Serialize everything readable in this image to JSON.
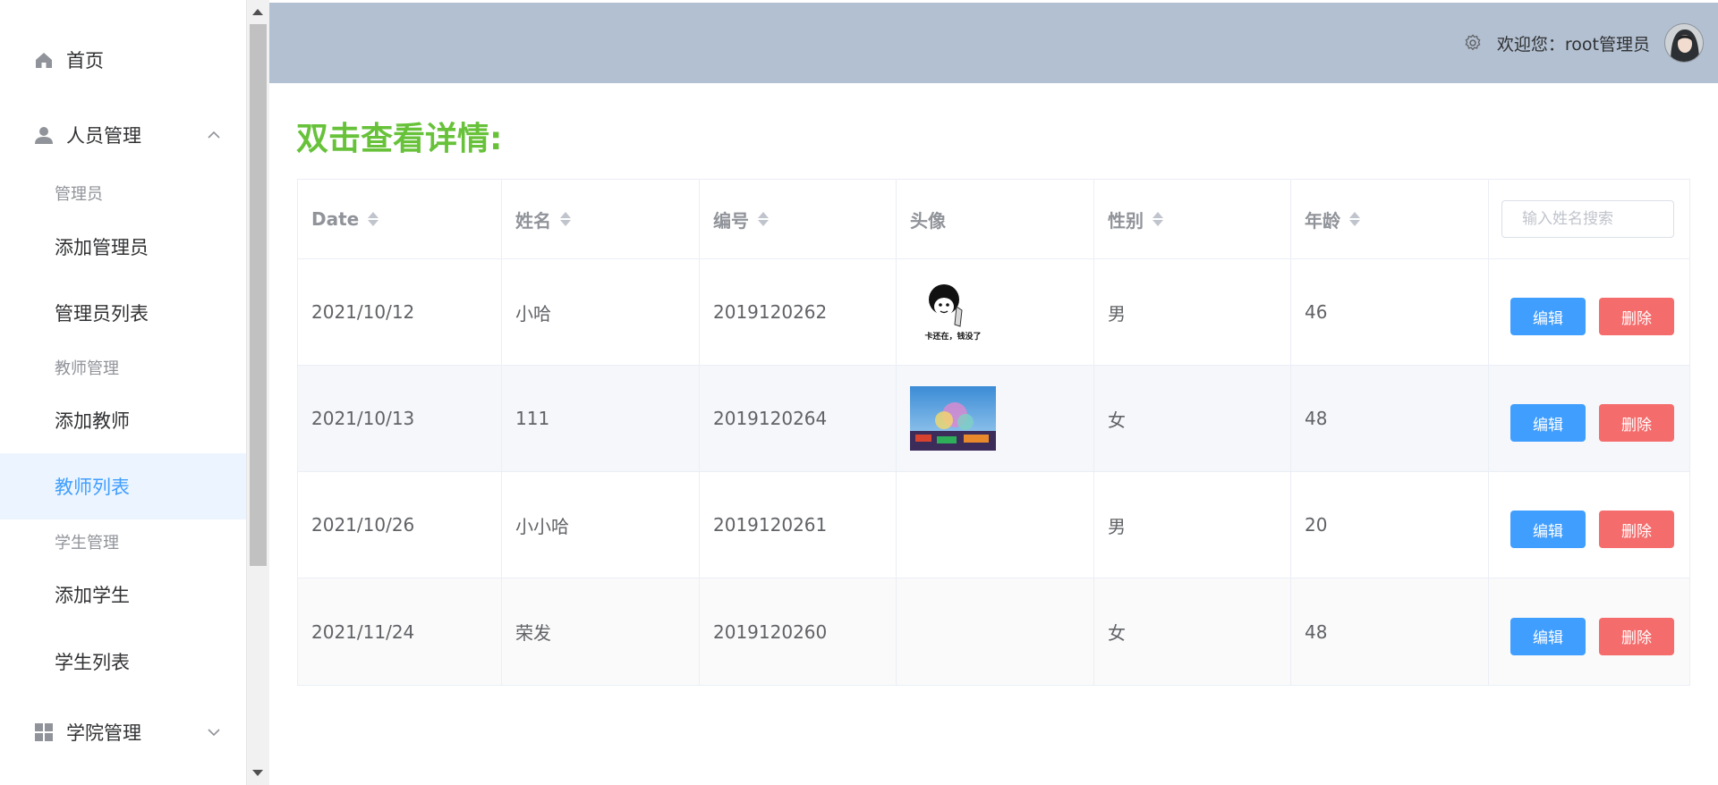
{
  "sidebar": {
    "home": "首页",
    "personnel": "人员管理",
    "admin_group": "管理员",
    "add_admin": "添加管理员",
    "admin_list": "管理员列表",
    "teacher_group": "教师管理",
    "add_teacher": "添加教师",
    "teacher_list": "教师列表",
    "student_group": "学生管理",
    "add_student": "添加学生",
    "student_list": "学生列表",
    "college": "学院管理"
  },
  "header": {
    "welcome": "欢迎您：root管理员"
  },
  "main": {
    "title": "双击查看详情:",
    "search_placeholder": "输入姓名搜索",
    "columns": [
      "Date",
      "姓名",
      "编号",
      "头像",
      "性别",
      "年龄"
    ],
    "edit_label": "编辑",
    "delete_label": "删除",
    "rows": [
      {
        "date": "2021/10/12",
        "name": "小哈",
        "id": "2019120262",
        "avatar_caption": "卡还在，钱没了",
        "gender": "男",
        "age": "46"
      },
      {
        "date": "2021/10/13",
        "name": "111",
        "id": "2019120264",
        "gender": "女",
        "age": "48"
      },
      {
        "date": "2021/10/26",
        "name": "小小哈",
        "id": "2019120261",
        "gender": "男",
        "age": "20"
      },
      {
        "date": "2021/11/24",
        "name": "荣发",
        "id": "2019120260",
        "gender": "女",
        "age": "48"
      }
    ]
  },
  "colors": {
    "accent": "#409eff",
    "danger": "#f56c6c",
    "title_green": "#67c23a",
    "header_bg": "#b3c0d1"
  }
}
